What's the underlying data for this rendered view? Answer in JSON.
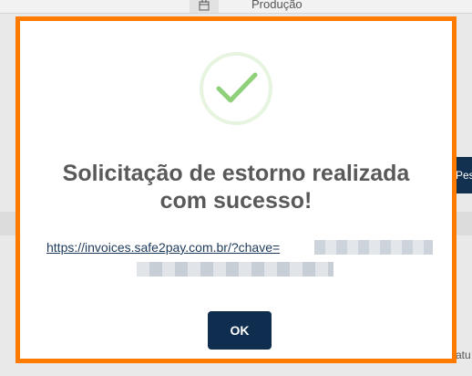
{
  "background": {
    "tab_label": "Produção",
    "right_button_label": "Pes",
    "bottom_right_text": "atu"
  },
  "modal": {
    "title_line1": "Solicitação de estorno realizada",
    "title_line2": "com sucesso!",
    "link_text": "https://invoices.safe2pay.com.br/?chave=",
    "ok_label": "OK",
    "icon": "check-circle-icon",
    "colors": {
      "frame": "#ff7a00",
      "check": "#8fd17a",
      "button": "#0e2d4f"
    }
  }
}
